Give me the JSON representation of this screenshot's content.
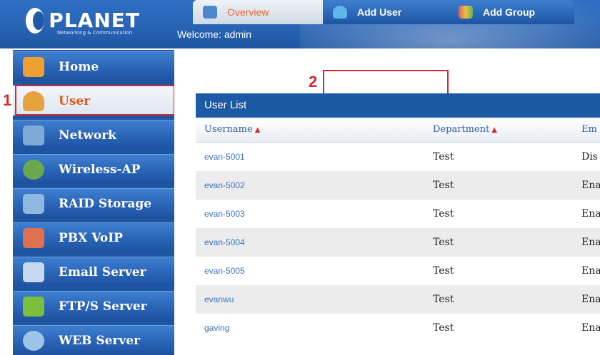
{
  "header": {
    "logo_text": "PLANET",
    "logo_subtext": "Networking & Communication",
    "welcome": "Welcome: admin"
  },
  "sidebar": {
    "items": [
      {
        "label": "Home",
        "icon": "home-icon",
        "icon_color": "#f0a030"
      },
      {
        "label": "User",
        "icon": "user-icon",
        "icon_color": "#e6a23c",
        "active": true
      },
      {
        "label": "Network",
        "icon": "network-icon",
        "icon_color": "#7fa9d8"
      },
      {
        "label": "Wireless-AP",
        "icon": "wireless-ap-icon",
        "icon_color": "#6aa84f"
      },
      {
        "label": "RAID Storage",
        "icon": "storage-icon",
        "icon_color": "#8fb8e0"
      },
      {
        "label": "PBX VoIP",
        "icon": "phone-icon",
        "icon_color": "#e07050"
      },
      {
        "label": "Email Server",
        "icon": "email-icon",
        "icon_color": "#c8d8f0"
      },
      {
        "label": "FTP/S Server",
        "icon": "folder-icon",
        "icon_color": "#7bbf3c"
      },
      {
        "label": "WEB Server",
        "icon": "web-icon",
        "icon_color": "#9ec3e8"
      }
    ]
  },
  "markers": {
    "one": "1",
    "two": "2"
  },
  "tabs": [
    {
      "label": "Overview",
      "icon": "overview-icon"
    },
    {
      "label": "Add User",
      "icon": "add-user-icon"
    },
    {
      "label": "Add Group",
      "icon": "add-group-icon"
    }
  ],
  "user_list": {
    "title": "User List",
    "columns": [
      "Username",
      "Department",
      "Em"
    ],
    "rows": [
      {
        "username": "evan-5001",
        "department": "Test",
        "status": "Dis"
      },
      {
        "username": "evan-5002",
        "department": "Test",
        "status": "Ena"
      },
      {
        "username": "evan-5003",
        "department": "Test",
        "status": "Ena"
      },
      {
        "username": "evan-5004",
        "department": "Test",
        "status": "Ena"
      },
      {
        "username": "evan-5005",
        "department": "Test",
        "status": "Ena"
      },
      {
        "username": "evanwu",
        "department": "Test",
        "status": "Ena"
      },
      {
        "username": "gaving",
        "department": "Test",
        "status": "Ena"
      }
    ]
  },
  "colors": {
    "accent_red": "#d9282f",
    "nav_blue": "#2a64b6",
    "link_blue": "#3c72c0"
  }
}
